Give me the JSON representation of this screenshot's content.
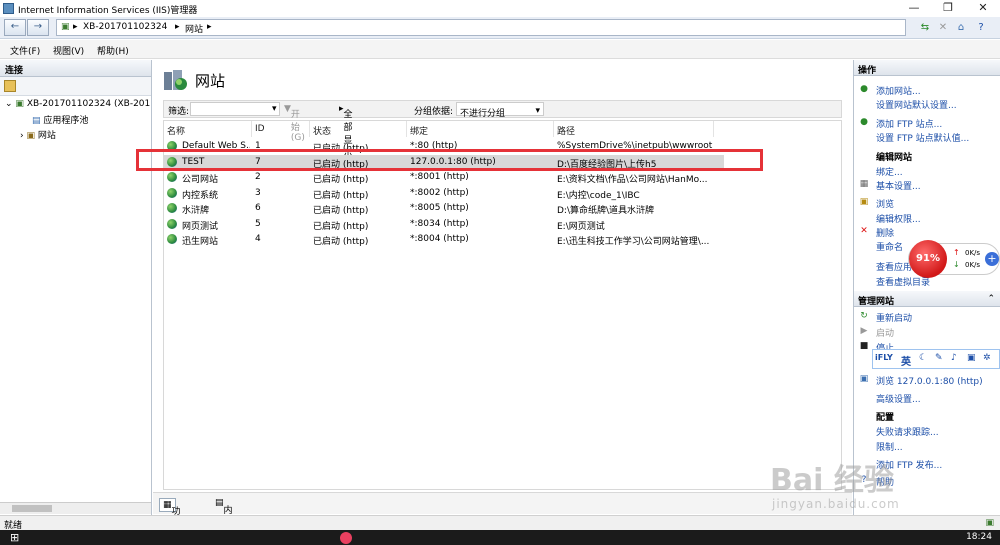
{
  "window": {
    "title": "Internet Information Services (IIS)管理器",
    "controls": [
      "—",
      "❐",
      "✕"
    ]
  },
  "address": {
    "segments": [
      "XB-201701102324",
      "网站"
    ]
  },
  "menu": [
    "文件(F)",
    "视图(V)",
    "帮助(H)"
  ],
  "left": {
    "header": "连接",
    "tree": [
      {
        "label": "XB-201701102324 (XB-201"
      },
      {
        "label": "应用程序池"
      },
      {
        "label": "网站"
      }
    ]
  },
  "center": {
    "title": "网站",
    "filter": {
      "label": "筛选:",
      "start": "开始(G)",
      "show_all": "全部显示(A)",
      "group_by": "分组依据:",
      "group_value": "不进行分组"
    },
    "columns": [
      "名称",
      "ID",
      "状态",
      "绑定",
      "路径"
    ],
    "rows": [
      {
        "name": "Default Web S...",
        "id": "1",
        "status": "已启动 (http)",
        "binding": "*:80 (http)",
        "path": "%SystemDrive%\\inetpub\\wwwroot"
      },
      {
        "name": "TEST",
        "id": "7",
        "status": "已启动 (http)",
        "binding": "127.0.0.1:80 (http)",
        "path": "D:\\百度经验图片\\上传h5"
      },
      {
        "name": "公司网站",
        "id": "2",
        "status": "已启动 (http)",
        "binding": "*:8001 (http)",
        "path": "E:\\资料文档\\作品\\公司网站\\HanMo..."
      },
      {
        "name": "内控系统",
        "id": "3",
        "status": "已启动 (http)",
        "binding": "*:8002 (http)",
        "path": "E:\\内控\\code_1\\IBC"
      },
      {
        "name": "水浒牌",
        "id": "6",
        "status": "已启动 (http)",
        "binding": "*:8005 (http)",
        "path": "D:\\算命纸牌\\道具水浒牌"
      },
      {
        "name": "网页测试",
        "id": "5",
        "status": "已启动 (http)",
        "binding": "*:8034 (http)",
        "path": "E:\\网页测试"
      },
      {
        "name": "迅生网站",
        "id": "4",
        "status": "已启动 (http)",
        "binding": "*:8004 (http)",
        "path": "E:\\迅生科技工作学习\\公司网站管理\\..."
      }
    ],
    "tabs": [
      "功能视图",
      "内容视图"
    ]
  },
  "right": {
    "header": "操作",
    "actions1": [
      "添加网站...",
      "设置网站默认设置...",
      "添加 FTP 站点...",
      "设置 FTP 站点默认值..."
    ],
    "edit_group": "编辑网站",
    "edit_items": [
      "绑定...",
      "基本设置...",
      "浏览",
      "编辑权限...",
      "删除",
      "重命名",
      "查看应用...",
      "查看虚拟目录"
    ],
    "manage_header": "管理网站",
    "manage_items": [
      "重新启动",
      "启动",
      "停止"
    ],
    "browse": "浏览 127.0.0.1:80 (http)",
    "advanced": "高级设置...",
    "config_group": "配置",
    "config_items": [
      "失败请求跟踪...",
      "限制...",
      "添加 FTP 发布...",
      "帮助"
    ]
  },
  "overlay": {
    "percent": "91%",
    "up": "0K/s",
    "down": "0K/s",
    "ime_lang": "英"
  },
  "watermark": {
    "main": "Bai 经验",
    "sub": "jingyan.baidu.com"
  },
  "status": "就绪",
  "clock": "18:24"
}
